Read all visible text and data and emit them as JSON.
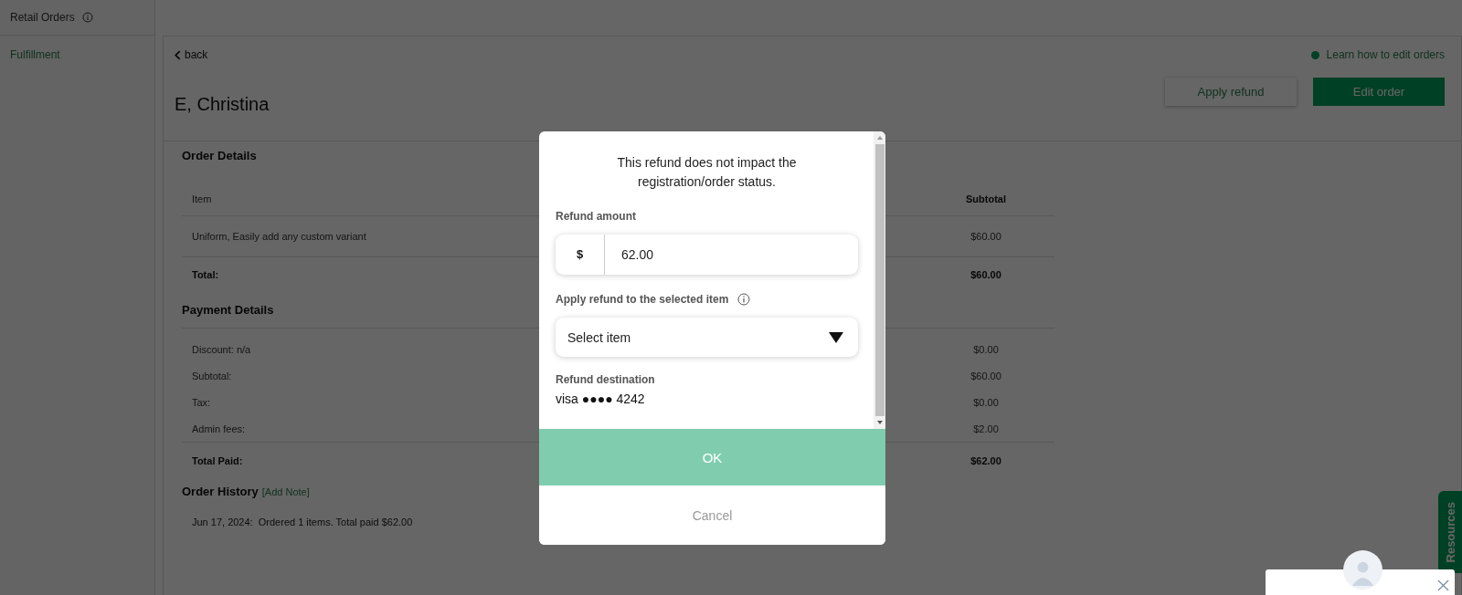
{
  "sidebar": {
    "header": "Retail Orders",
    "items": [
      {
        "label": "Fulfillment",
        "selected": true
      }
    ]
  },
  "page": {
    "back": "back",
    "help_link": "Learn how to edit orders",
    "customer_name": "E, Christina",
    "buttons": [
      {
        "label": "Apply refund",
        "kind": "secondary"
      },
      {
        "label": "Edit order",
        "kind": "primary"
      }
    ]
  },
  "order_details": {
    "title": "Order Details",
    "columns": [
      "Item",
      "Subtotal"
    ],
    "rows": [
      {
        "item": "Uniform, Easily add any custom variant",
        "subtotal": "$60.00"
      }
    ],
    "total": {
      "label": "Total:",
      "value": "$60.00"
    }
  },
  "payment_details": {
    "title": "Payment Details",
    "rows": [
      {
        "label": "Discount: n/a",
        "value": "$0.00"
      },
      {
        "label": "Subtotal:",
        "value": "$60.00"
      },
      {
        "label": "Tax:",
        "value": "$0.00"
      },
      {
        "label": "Admin fees:",
        "value": "$2.00"
      }
    ],
    "total": {
      "label": "Total Paid:",
      "value": "$62.00"
    }
  },
  "order_history": {
    "title": "Order History",
    "add_note": "[Add Note]",
    "entries": [
      "Jun 17, 2024:  Ordered 1 items. Total paid $62.00"
    ]
  },
  "dialog": {
    "message": "This refund does not impact the registration/order status.",
    "amount_label": "Refund amount",
    "currency": "$",
    "amount": "62.00",
    "item_label": "Apply refund to the selected item",
    "item_placeholder": "Select item",
    "destination_label": "Refund destination",
    "destination": "visa ●●●● 4242",
    "ok": "OK",
    "cancel": "Cancel"
  },
  "resources_tab": "Resources"
}
